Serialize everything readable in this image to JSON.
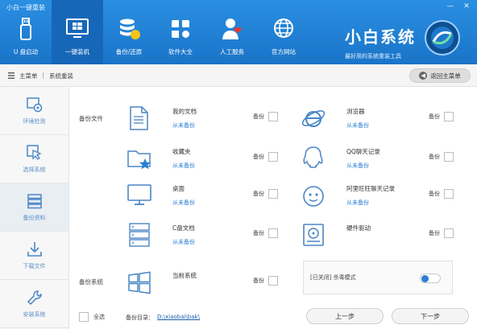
{
  "window": {
    "title": "小白一键重装",
    "minimize": "—",
    "close": "✕"
  },
  "nav": {
    "items": [
      {
        "label": "U 盘启动",
        "icon": "usb-icon"
      },
      {
        "label": "一键装机",
        "icon": "monitor-windows-icon"
      },
      {
        "label": "备份/还原",
        "icon": "database-icon"
      },
      {
        "label": "软件大全",
        "icon": "apps-icon"
      },
      {
        "label": "人工服务",
        "icon": "person-service-icon"
      },
      {
        "label": "官方网站",
        "icon": "globe-icon"
      }
    ]
  },
  "brand": {
    "name": "小白系统",
    "slogan": "最好用的系统重装工具"
  },
  "breadcrumb": {
    "home": "主菜单",
    "separator": "|",
    "current": "系统重装"
  },
  "back_button": "返回主菜单",
  "sidebar": {
    "items": [
      {
        "label": "环境检测",
        "icon": "env-check-icon"
      },
      {
        "label": "选择系统",
        "icon": "cursor-select-icon"
      },
      {
        "label": "备份资料",
        "icon": "backup-stack-icon"
      },
      {
        "label": "下载文件",
        "icon": "download-icon"
      },
      {
        "label": "安装系统",
        "icon": "wrench-icon"
      }
    ]
  },
  "sections": {
    "files": "备份文件",
    "system": "备份系统"
  },
  "left_items": [
    {
      "name": "我的文档",
      "status": "从未备份",
      "backup_label": "备份",
      "icon": "document-icon"
    },
    {
      "name": "收藏夹",
      "status": "从未备份",
      "backup_label": "备份",
      "icon": "favorites-folder-icon"
    },
    {
      "name": "桌面",
      "status": "从未备份",
      "backup_label": "备份",
      "icon": "desktop-monitor-icon"
    },
    {
      "name": "C盘文档",
      "status": "从未备份",
      "backup_label": "备份",
      "icon": "drive-c-icon"
    },
    {
      "name": "当前系统",
      "status": "",
      "backup_label": "备份",
      "icon": "windows-logo-icon"
    }
  ],
  "right_items": [
    {
      "name": "浏览器",
      "status": "从未备份",
      "backup_label": "备份",
      "icon": "ie-browser-icon"
    },
    {
      "name": "QQ聊天记录",
      "status": "从未备份",
      "backup_label": "备份",
      "icon": "qq-icon"
    },
    {
      "name": "阿里旺旺聊天记录",
      "status": "从未备份",
      "backup_label": "备份",
      "icon": "wangwang-icon"
    },
    {
      "name": "硬件驱动",
      "status": "从未备份",
      "backup_label": "备份",
      "icon": "hardware-driver-icon"
    }
  ],
  "antivirus": {
    "label": "[已关闭] 杀毒模式",
    "enabled": false
  },
  "footer": {
    "select_all": "全选",
    "dir_label": "备份目录：",
    "dir_value": "D:\\xiaobai\\bak\\",
    "prev": "上一步",
    "next": "下一步"
  },
  "colors": {
    "nav_bg": "#1a74c8",
    "accent": "#2a7fd4",
    "link": "#1a5fb0"
  }
}
